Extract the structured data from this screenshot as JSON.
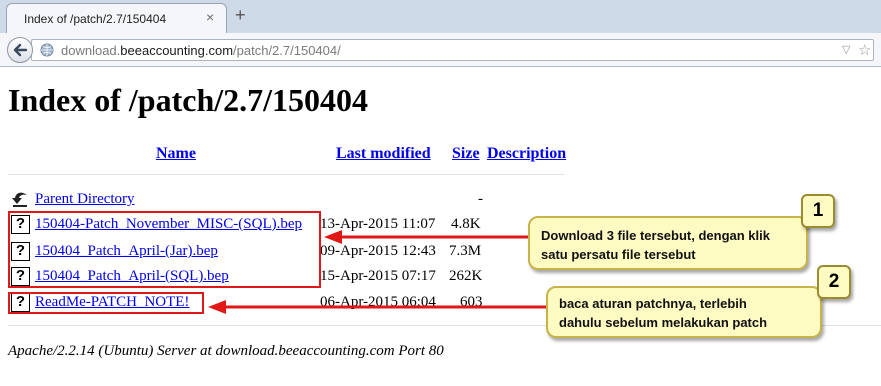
{
  "browser": {
    "tab_title": "Index of /patch/2.7/150404",
    "tab_close_glyph": "×",
    "new_tab_glyph": "+",
    "url_prefix": "download.",
    "url_domain": "beeaccounting.com",
    "url_path": "/patch/2.7/150404/",
    "url_dropdown_glyph": "▽",
    "url_reload_glyph": "☆"
  },
  "page": {
    "title": "Index of /patch/2.7/150404",
    "columns": {
      "name": "Name",
      "last_modified": "Last modified",
      "size": "Size",
      "description": "Description"
    },
    "parent": {
      "label": "Parent Directory",
      "size": "-"
    },
    "files": [
      {
        "name": "150404-Patch_November_MISC-(SQL).bep",
        "modified": "13-Apr-2015 11:07",
        "size": "4.8K"
      },
      {
        "name": "150404_Patch_April-(Jar).bep",
        "modified": "09-Apr-2015 12:43",
        "size": "7.3M"
      },
      {
        "name": "150404_Patch_April-(SQL).bep",
        "modified": "15-Apr-2015 07:17",
        "size": "262K"
      },
      {
        "name": "ReadMe-PATCH_NOTE!",
        "modified": "06-Apr-2015 06:04",
        "size": "603"
      }
    ],
    "file_icon_glyph": "?",
    "footer": "Apache/2.2.14 (Ubuntu) Server at download.beeaccounting.com Port 80"
  },
  "annotations": {
    "callout1": {
      "number": "1",
      "line1": "Download 3 file tersebut, dengan klik",
      "line2": "satu persatu file tersebut"
    },
    "callout2": {
      "number": "2",
      "line1": "baca aturan patchnya, terlebih",
      "line2": "dahulu sebelum melakukan patch"
    },
    "highlight_color": "#e01818",
    "callout_bg": "#fdfac2"
  }
}
